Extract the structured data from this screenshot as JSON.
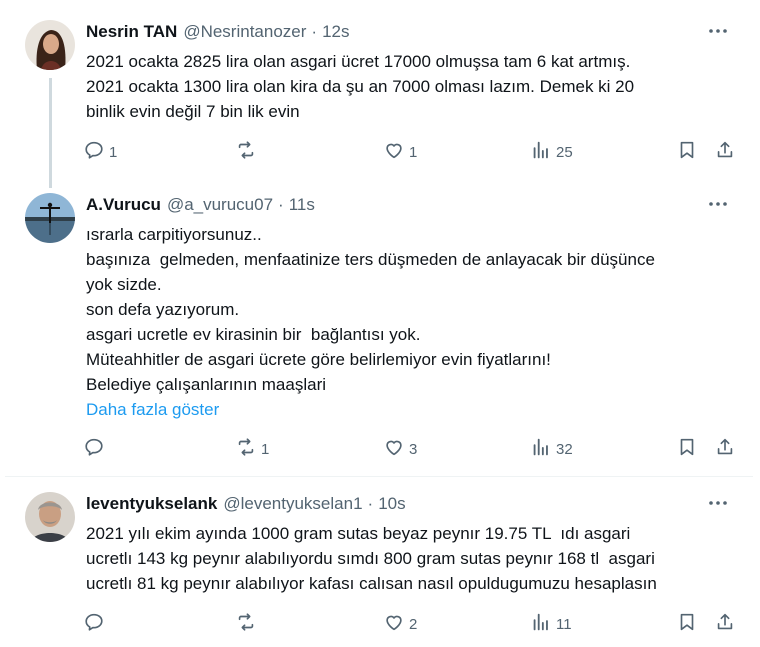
{
  "tweets": [
    {
      "name": "Nesrin TAN",
      "handle": "@Nesrintanozer",
      "separator": "·",
      "time": "12s",
      "lines": [
        "2021 ocakta 2825 lira olan asgari ücret 17000 olmuşsa tam 6 kat artmış.",
        "2021 ocakta 1300 lira olan kira da şu an 7000 olması lazım. Demek ki 20",
        "binlik evin değil 7 bin lik evin"
      ],
      "replies": "1",
      "retweets": "",
      "likes": "1",
      "views": "25"
    },
    {
      "name": "A.Vurucu",
      "handle": "@a_vurucu07",
      "separator": "·",
      "time": "11s",
      "lines": [
        "ısrarla carpitiyorsunuz..",
        "başınıza  gelmeden, menfaatinize ters düşmeden de anlayacak bir düşünce",
        "yok sizde.",
        "son defa yazıyorum.",
        "asgari ucretle ev kirasinin bir  bağlantısı yok.",
        "Müteahhitler de asgari ücrete göre belirlemiyor evin fiyatlarını!",
        "Belediye çalışanlarının maaşlari"
      ],
      "show_more": "Daha fazla göster",
      "replies": "",
      "retweets": "1",
      "likes": "3",
      "views": "32"
    },
    {
      "name": "leventyukselank",
      "handle": "@leventyukselan1",
      "separator": "·",
      "time": "10s",
      "lines": [
        "2021 yılı ekim ayında 1000 gram sutas beyaz peynır 19.75 TL  ıdı asgari",
        "ucretlı 143 kg peynır alabılıyordu sımdı 800 gram sutas peynır 168 tl  asgari",
        "ucretlı 81 kg peynır alabılıyor kafası calısan nasıl opuldugumuzu hesaplasın"
      ],
      "replies": "",
      "retweets": "",
      "likes": "2",
      "views": "11"
    }
  ],
  "icons": {
    "reply": "reply-icon",
    "retweet": "retweet-icon",
    "like": "heart-icon",
    "views": "views-icon",
    "bookmark": "bookmark-icon",
    "share": "share-icon",
    "more": "more-icon"
  },
  "colors": {
    "text": "#0f1419",
    "secondary": "#536471",
    "link": "#1d9bf0",
    "divider": "#eff3f4",
    "thread_line": "#cfd9de"
  }
}
